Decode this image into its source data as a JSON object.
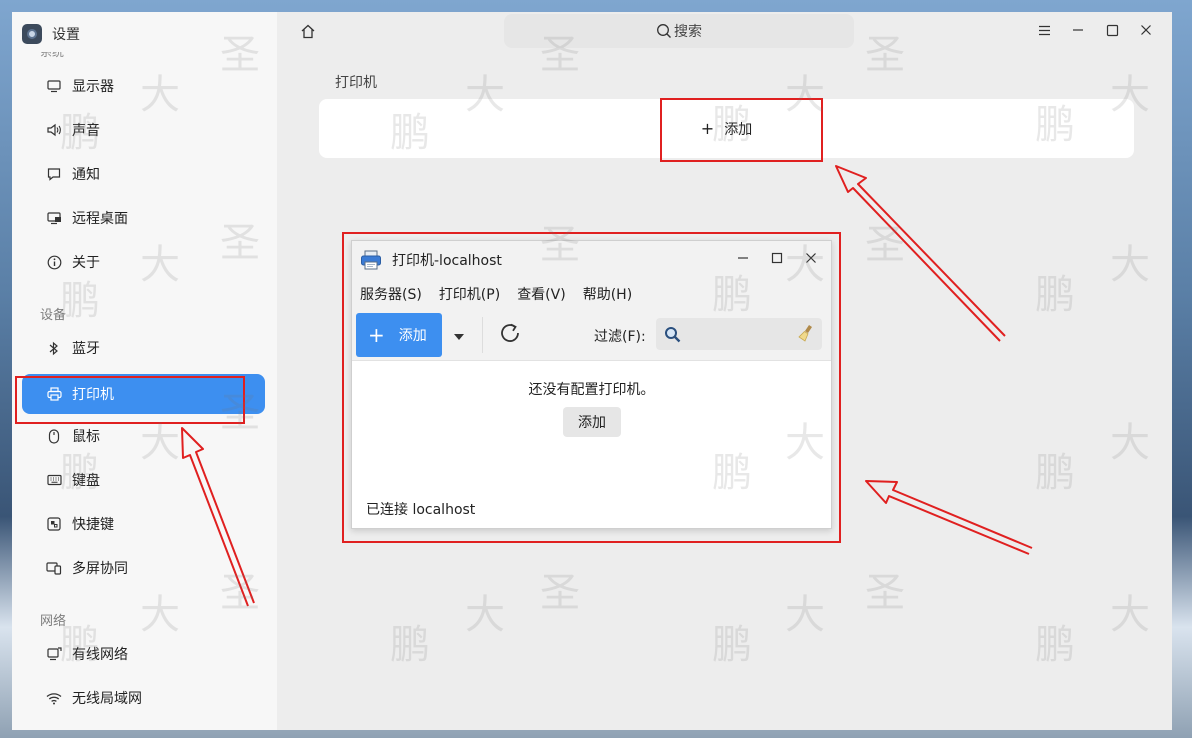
{
  "app": {
    "title": "设置"
  },
  "sidebar": {
    "cut_group": "系统",
    "groups": [
      {
        "label": "",
        "items": [
          {
            "icon": "monitor-icon",
            "label": "显示器"
          },
          {
            "icon": "speaker-icon",
            "label": "声音"
          },
          {
            "icon": "chat-bubble-icon",
            "label": "通知"
          },
          {
            "icon": "remote-desktop-icon",
            "label": "远程桌面"
          },
          {
            "icon": "info-icon",
            "label": "关于"
          }
        ]
      }
    ],
    "device_group": "设备",
    "device_items": [
      {
        "icon": "bluetooth-icon",
        "label": "蓝牙"
      },
      {
        "icon": "printer-icon",
        "label": "打印机",
        "active": true
      },
      {
        "icon": "mouse-icon",
        "label": "鼠标"
      },
      {
        "icon": "keyboard-icon",
        "label": "键盘"
      },
      {
        "icon": "shortcut-icon",
        "label": "快捷键"
      },
      {
        "icon": "multiscreen-icon",
        "label": "多屏协同"
      }
    ],
    "network_group": "网络",
    "network_items": [
      {
        "icon": "ethernet-icon",
        "label": "有线网络"
      },
      {
        "icon": "wifi-icon",
        "label": "无线局域网"
      }
    ]
  },
  "main": {
    "search_label": "搜索",
    "section_title": "打印机",
    "add_label": "添加"
  },
  "dialog": {
    "title": "打印机-localhost",
    "menu": [
      "服务器(S)",
      "打印机(P)",
      "查看(V)",
      "帮助(H)"
    ],
    "toolbar": {
      "add_label": "添加",
      "filter_label": "过滤(F):"
    },
    "empty_message": "还没有配置打印机。",
    "empty_add": "添加",
    "status": "已连接 localhost"
  },
  "watermark": [
    "大",
    "圣",
    "鹏"
  ],
  "colors": {
    "accent": "#3d8ff0",
    "annotation": "#e02020"
  }
}
